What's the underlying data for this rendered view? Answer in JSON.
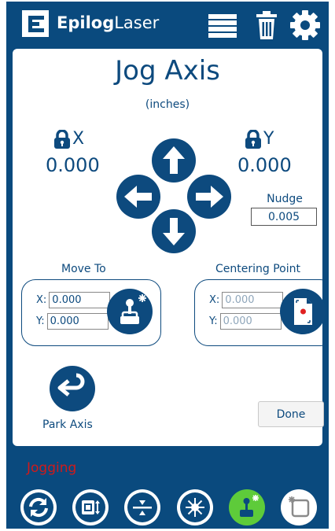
{
  "colors": {
    "brand_blue": "#0a4a7e",
    "text_blue": "#0d4a7e",
    "status_red": "#d11a1a",
    "active_green": "#5ecb3a"
  },
  "header": {
    "brand_bold": "Epilog",
    "brand_light": "Laser",
    "icons": [
      "logo-icon",
      "list-icon",
      "trash-icon",
      "gear-icon"
    ]
  },
  "jog": {
    "title": "Jog Axis",
    "units": "(inches)",
    "x_label": "X",
    "y_label": "Y",
    "x_value": "0.000",
    "y_value": "0.000",
    "nudge_label": "Nudge",
    "nudge_value": "0.005"
  },
  "move_to": {
    "label": "Move To",
    "x_prefix": "X:",
    "y_prefix": "Y:",
    "x_value": "0.000",
    "y_value": "0.000"
  },
  "centering": {
    "label": "Centering Point",
    "x_prefix": "X:",
    "y_prefix": "Y:",
    "x_value": "0.000",
    "y_value": "0.000"
  },
  "park_label": "Park Axis",
  "done_label": "Done",
  "status": "Jogging",
  "bottom_icons": [
    "refresh-icon",
    "camera-icon",
    "focus-icon",
    "laser-icon",
    "jog-icon",
    "frame-icon"
  ]
}
